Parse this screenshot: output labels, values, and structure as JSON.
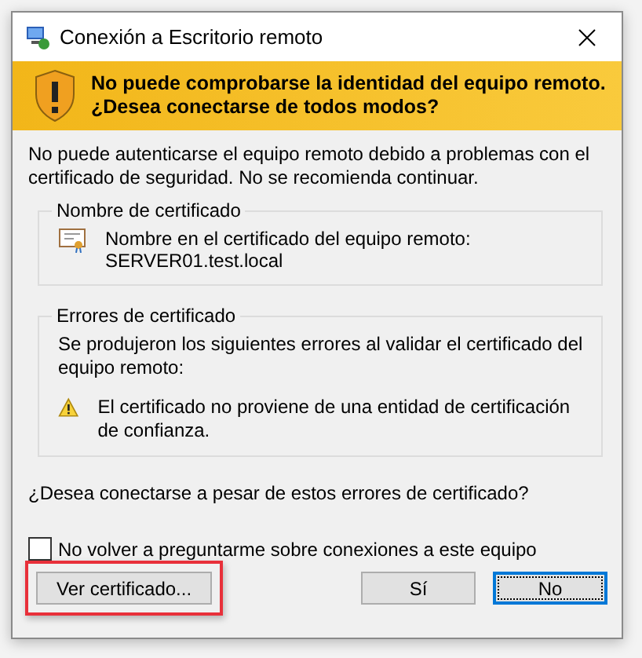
{
  "window": {
    "title": "Conexión a Escritorio remoto"
  },
  "banner": {
    "lines": [
      "No puede comprobarse la identidad del equipo remoto.",
      "¿Desea conectarse de todos modos?"
    ]
  },
  "intro": "No puede autenticarse el equipo remoto debido a problemas con el certificado de seguridad. No se recomienda continuar.",
  "certificate_name": {
    "legend": "Nombre de certificado",
    "label": "Nombre en el certificado del equipo remoto:",
    "value": "SERVER01.test.local"
  },
  "certificate_errors": {
    "legend": "Errores de certificado",
    "description": "Se produjeron los siguientes errores al validar el certificado del equipo remoto:",
    "errors": [
      "El certificado no proviene de una entidad de certificación de confianza."
    ]
  },
  "question": "¿Desea conectarse a pesar de estos errores de certificado?",
  "dont_ask": {
    "label": "No volver a preguntarme sobre conexiones a este equipo",
    "checked": false
  },
  "buttons": [
    {
      "label": "Ver certificado...",
      "highlighted": true,
      "focused": false
    },
    {
      "label": "Sí",
      "highlighted": false,
      "focused": false
    },
    {
      "label": "No",
      "highlighted": false,
      "focused": true
    }
  ]
}
